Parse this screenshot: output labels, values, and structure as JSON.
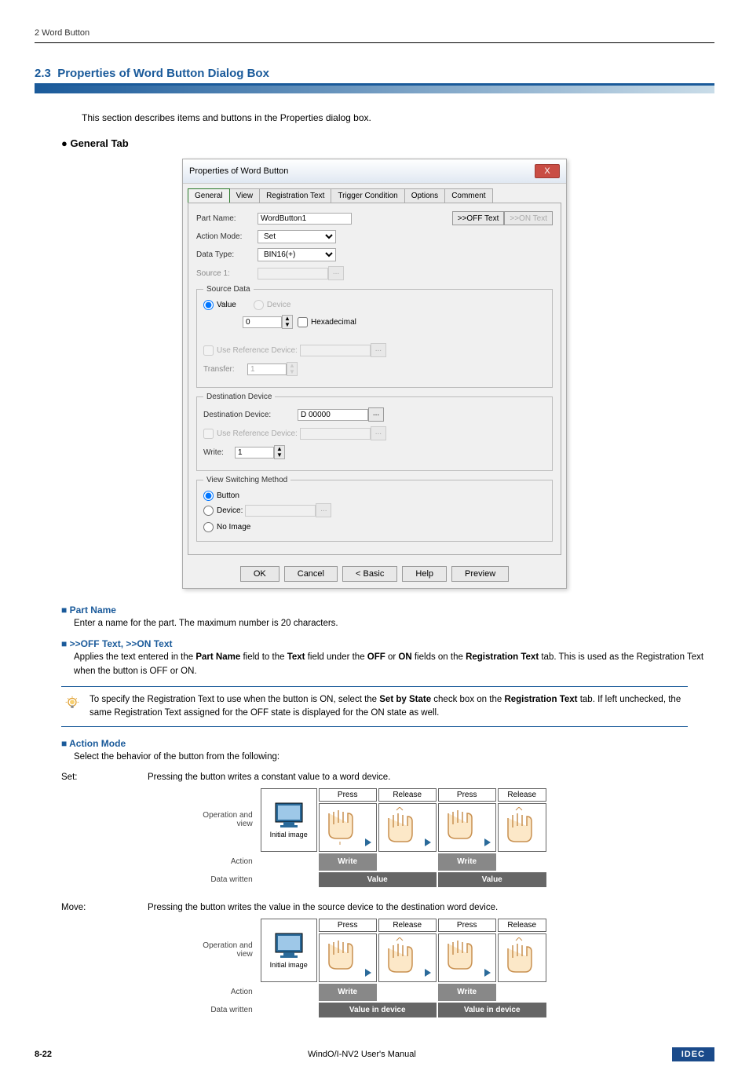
{
  "header": {
    "chapter": "2 Word Button"
  },
  "section": {
    "number": "2.3",
    "title": "Properties of Word Button Dialog Box",
    "intro": "This section describes items and buttons in the Properties dialog box."
  },
  "generalTab": {
    "heading": "General Tab"
  },
  "dialog": {
    "title": "Properties of Word Button",
    "close": "X",
    "tabs": [
      "General",
      "View",
      "Registration Text",
      "Trigger Condition",
      "Options",
      "Comment"
    ],
    "partNameLabel": "Part Name:",
    "partNameValue": "WordButton1",
    "offTextBtn": ">>OFF Text",
    "onTextBtn": ">>ON Text",
    "actionModeLabel": "Action Mode:",
    "actionModeValue": "Set",
    "dataTypeLabel": "Data Type:",
    "dataTypeValue": "BIN16(+)",
    "source1Label": "Source 1:",
    "sourceData": {
      "legend": "Source Data",
      "valueRadio": "Value",
      "deviceRadio": "Device",
      "valueInput": "0",
      "hexCheck": "Hexadecimal",
      "useRefCheck": "Use Reference Device:",
      "transferLabel": "Transfer:",
      "transferValue": "1"
    },
    "destDevice": {
      "legend": "Destination Device",
      "destLabel": "Destination Device:",
      "destValue": "D 00000",
      "useRefCheck": "Use Reference Device:",
      "writeLabel": "Write:",
      "writeValue": "1"
    },
    "viewSwitching": {
      "legend": "View Switching Method",
      "buttonRadio": "Button",
      "deviceRadio": "Device:",
      "noImageRadio": "No Image"
    },
    "buttons": {
      "ok": "OK",
      "cancel": "Cancel",
      "basic": "< Basic",
      "help": "Help",
      "preview": "Preview"
    }
  },
  "partName": {
    "hdr": "Part Name",
    "txt": "Enter a name for the part. The maximum number is 20 characters."
  },
  "offOn": {
    "hdr": ">>OFF Text, >>ON Text",
    "txt1": "Applies the text entered in the ",
    "b1": "Part Name",
    "txt2": " field to the ",
    "b2": "Text",
    "txt3": " field under the ",
    "b3": "OFF",
    "txt4": " or ",
    "b4": "ON",
    "txt5": " fields on the ",
    "b5": "Registration Text",
    "txt6": " tab. This is used as the Registration Text when the button is OFF or ON."
  },
  "note": {
    "txt1": "To specify the Registration Text to use when the button is ON, select the ",
    "b1": "Set by State",
    "txt2": " check box on the ",
    "b2": "Registration Text",
    "txt3": " tab. If left unchecked, the same Registration Text assigned for the OFF state is displayed for the ON state as well."
  },
  "actionMode": {
    "hdr": "Action Mode",
    "txt": "Select the behavior of the button from the following:"
  },
  "defs": {
    "set": {
      "term": "Set:",
      "desc": "Pressing the button writes a constant value to a word device."
    },
    "move": {
      "term": "Move:",
      "desc": "Pressing the button writes the value in the source device to the destination word device."
    }
  },
  "diagLabels": {
    "opView1": "Operation and",
    "opView2": "view",
    "action": "Action",
    "dataWritten": "Data written",
    "initial": "Initial image",
    "press": "Press",
    "release": "Release",
    "write": "Write",
    "value": "Value",
    "valueInDevice": "Value in device"
  },
  "footer": {
    "pageno": "8-22",
    "manual": "WindO/I-NV2 User's Manual",
    "logo": "IDEC"
  }
}
